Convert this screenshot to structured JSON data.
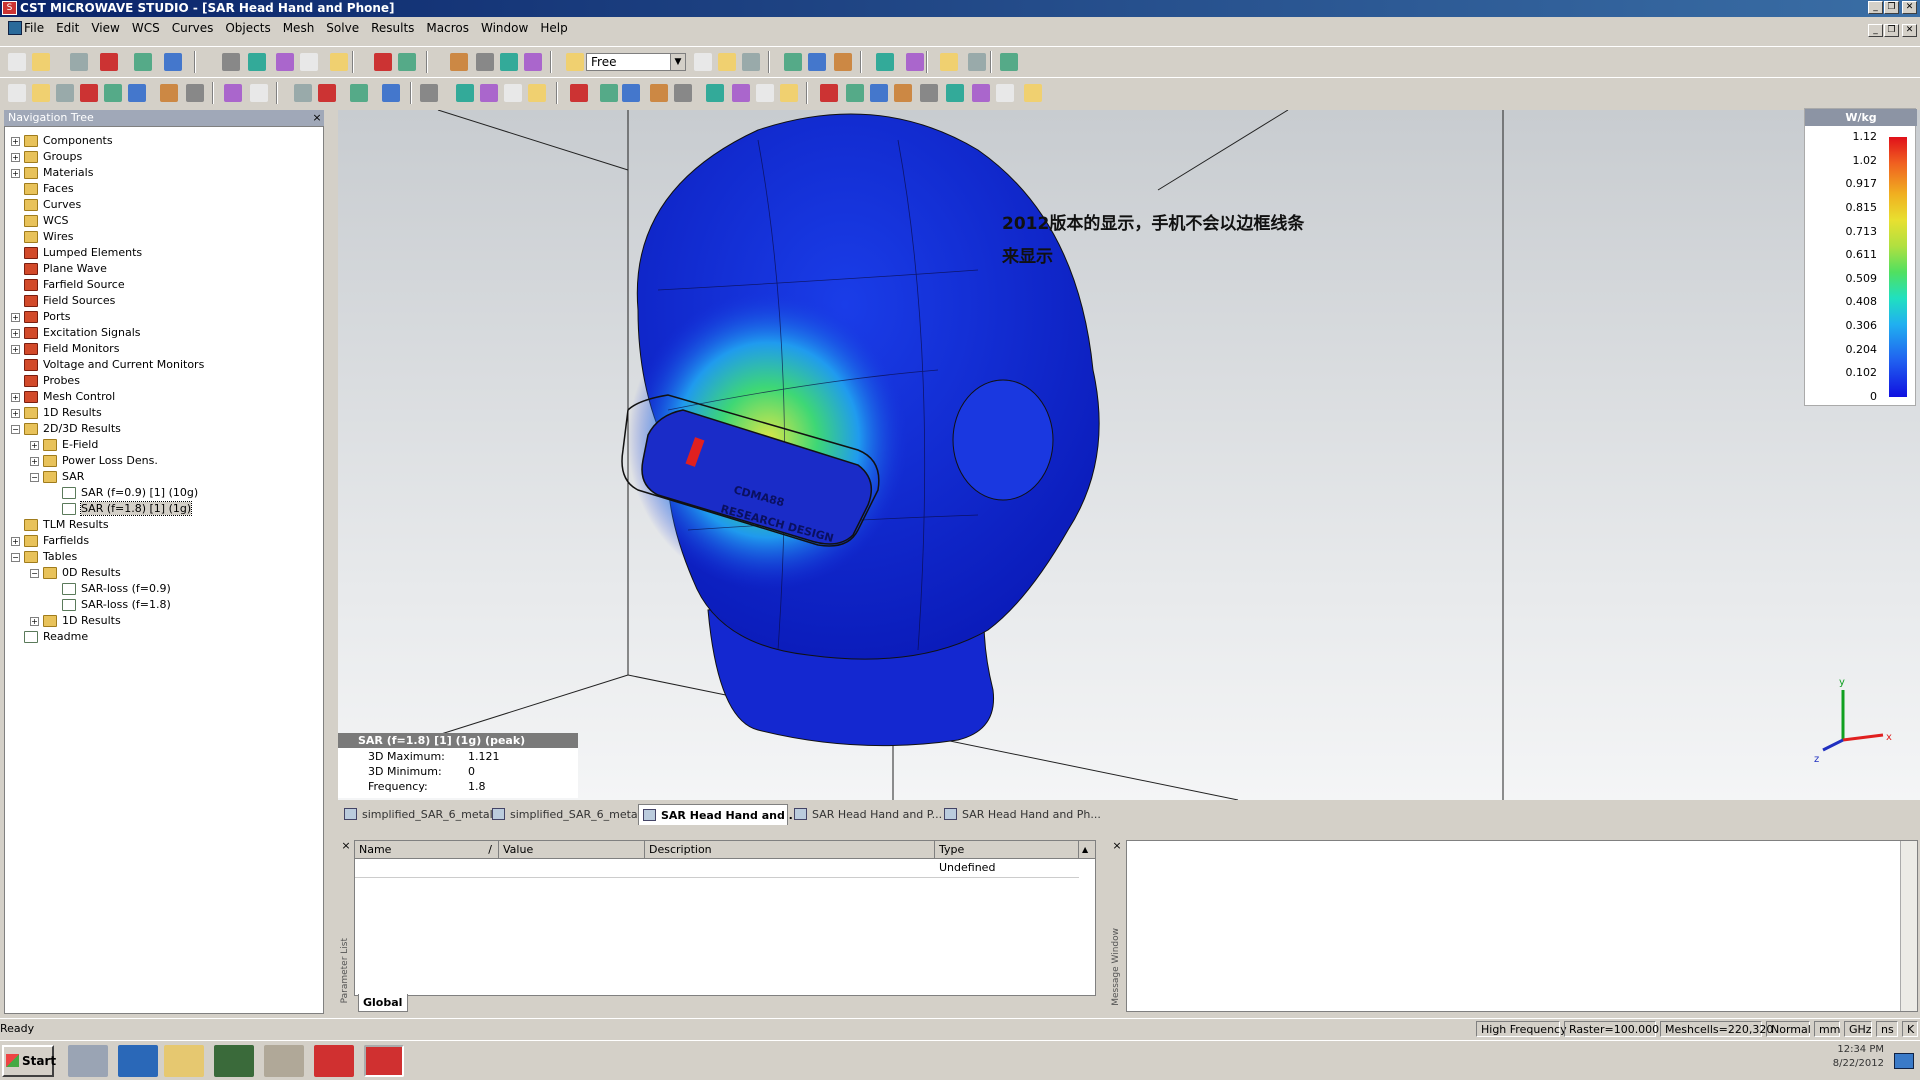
{
  "window": {
    "title": "CST MICROWAVE STUDIO - [SAR Head Hand and Phone]",
    "app_icon_label": "S",
    "controls": [
      "_",
      "❐",
      "✕"
    ]
  },
  "menu": [
    "File",
    "Edit",
    "View",
    "WCS",
    "Curves",
    "Objects",
    "Mesh",
    "Solve",
    "Results",
    "Macros",
    "Window",
    "Help"
  ],
  "toolbar": {
    "mode_select": "Free"
  },
  "nav_tree": {
    "title": "Navigation Tree",
    "close": "×",
    "items": [
      {
        "label": "Components",
        "depth": 0,
        "exp": "+",
        "icon": "folder"
      },
      {
        "label": "Groups",
        "depth": 0,
        "exp": "+",
        "icon": "folder"
      },
      {
        "label": "Materials",
        "depth": 0,
        "exp": "+",
        "icon": "folder"
      },
      {
        "label": "Faces",
        "depth": 0,
        "exp": "",
        "icon": "folder"
      },
      {
        "label": "Curves",
        "depth": 0,
        "exp": "",
        "icon": "folder"
      },
      {
        "label": "WCS",
        "depth": 0,
        "exp": "",
        "icon": "folder"
      },
      {
        "label": "Wires",
        "depth": 0,
        "exp": "",
        "icon": "folder"
      },
      {
        "label": "Lumped Elements",
        "depth": 0,
        "exp": "",
        "icon": "red"
      },
      {
        "label": "Plane Wave",
        "depth": 0,
        "exp": "",
        "icon": "red"
      },
      {
        "label": "Farfield Source",
        "depth": 0,
        "exp": "",
        "icon": "red"
      },
      {
        "label": "Field Sources",
        "depth": 0,
        "exp": "",
        "icon": "red"
      },
      {
        "label": "Ports",
        "depth": 0,
        "exp": "+",
        "icon": "red"
      },
      {
        "label": "Excitation Signals",
        "depth": 0,
        "exp": "+",
        "icon": "red"
      },
      {
        "label": "Field Monitors",
        "depth": 0,
        "exp": "+",
        "icon": "red"
      },
      {
        "label": "Voltage and Current Monitors",
        "depth": 0,
        "exp": "",
        "icon": "red"
      },
      {
        "label": "Probes",
        "depth": 0,
        "exp": "",
        "icon": "red"
      },
      {
        "label": "Mesh Control",
        "depth": 0,
        "exp": "+",
        "icon": "red"
      },
      {
        "label": "1D Results",
        "depth": 0,
        "exp": "+",
        "icon": "folder"
      },
      {
        "label": "2D/3D Results",
        "depth": 0,
        "exp": "−",
        "icon": "folder"
      },
      {
        "label": "E-Field",
        "depth": 1,
        "exp": "+",
        "icon": "folder"
      },
      {
        "label": "Power Loss Dens.",
        "depth": 1,
        "exp": "+",
        "icon": "folder"
      },
      {
        "label": "SAR",
        "depth": 1,
        "exp": "−",
        "icon": "folder"
      },
      {
        "label": "SAR (f=0.9) [1] (10g)",
        "depth": 2,
        "exp": "",
        "icon": "res"
      },
      {
        "label": "SAR (f=1.8) [1] (1g)",
        "depth": 2,
        "exp": "",
        "icon": "res",
        "selected": true
      },
      {
        "label": "TLM Results",
        "depth": 0,
        "exp": "",
        "icon": "folder"
      },
      {
        "label": "Farfields",
        "depth": 0,
        "exp": "+",
        "icon": "folder"
      },
      {
        "label": "Tables",
        "depth": 0,
        "exp": "−",
        "icon": "folder"
      },
      {
        "label": "0D Results",
        "depth": 1,
        "exp": "−",
        "icon": "folder"
      },
      {
        "label": "SAR-loss (f=0.9)",
        "depth": 2,
        "exp": "",
        "icon": "res"
      },
      {
        "label": "SAR-loss (f=1.8)",
        "depth": 2,
        "exp": "",
        "icon": "res"
      },
      {
        "label": "1D Results",
        "depth": 1,
        "exp": "+",
        "icon": "folder"
      },
      {
        "label": "Readme",
        "depth": 0,
        "exp": "",
        "icon": "res"
      }
    ]
  },
  "viewport": {
    "annotation_line1": "2012版本的显示，手机不会以边框线条",
    "annotation_line2": "来显示",
    "phone_label1": "CDMA88",
    "phone_label2": "RESEARCH DESIGN",
    "axis_y": "y",
    "axis_x": "x",
    "axis_z": "z"
  },
  "legend": {
    "title": "W/kg",
    "values": [
      "1.12",
      "1.02",
      "0.917",
      "0.815",
      "0.713",
      "0.611",
      "0.509",
      "0.408",
      "0.306",
      "0.204",
      "0.102",
      "0"
    ]
  },
  "info": {
    "title": "SAR (f=1.8) [1] (1g) (peak)",
    "rows": [
      {
        "label": "3D Maximum:",
        "value": "1.121"
      },
      {
        "label": "3D Minimum:",
        "value": "0"
      },
      {
        "label": "Frequency:",
        "value": "1.8"
      }
    ]
  },
  "doc_tabs": [
    {
      "label": "simplified_SAR_6_metal1",
      "active": false
    },
    {
      "label": "simplified_SAR_6_metal1",
      "active": false
    },
    {
      "label": "SAR Head Hand and ...",
      "active": true
    },
    {
      "label": "SAR Head Hand and P...",
      "active": false
    },
    {
      "label": "SAR Head Hand and Ph...",
      "active": false
    }
  ],
  "param_list": {
    "side_label": "Parameter List",
    "close": "×",
    "columns": [
      "Name",
      "Value",
      "Description",
      "Type"
    ],
    "sort_indicator": "/",
    "row": {
      "name": "",
      "value": "",
      "description": "",
      "type": "Undefined"
    },
    "tab": "Global"
  },
  "message_window": {
    "side_label": "Message Window",
    "close": "×"
  },
  "status": {
    "left": "Ready",
    "frequency_mode": "High Frequency",
    "raster": "Raster=100.000",
    "meshcells": "Meshcells=220,320",
    "view": "Normal",
    "units": [
      "mm",
      "GHz",
      "ns",
      "K"
    ]
  },
  "taskbar": {
    "start": "Start",
    "time": "12:34 PM",
    "date": "8/22/2012"
  }
}
